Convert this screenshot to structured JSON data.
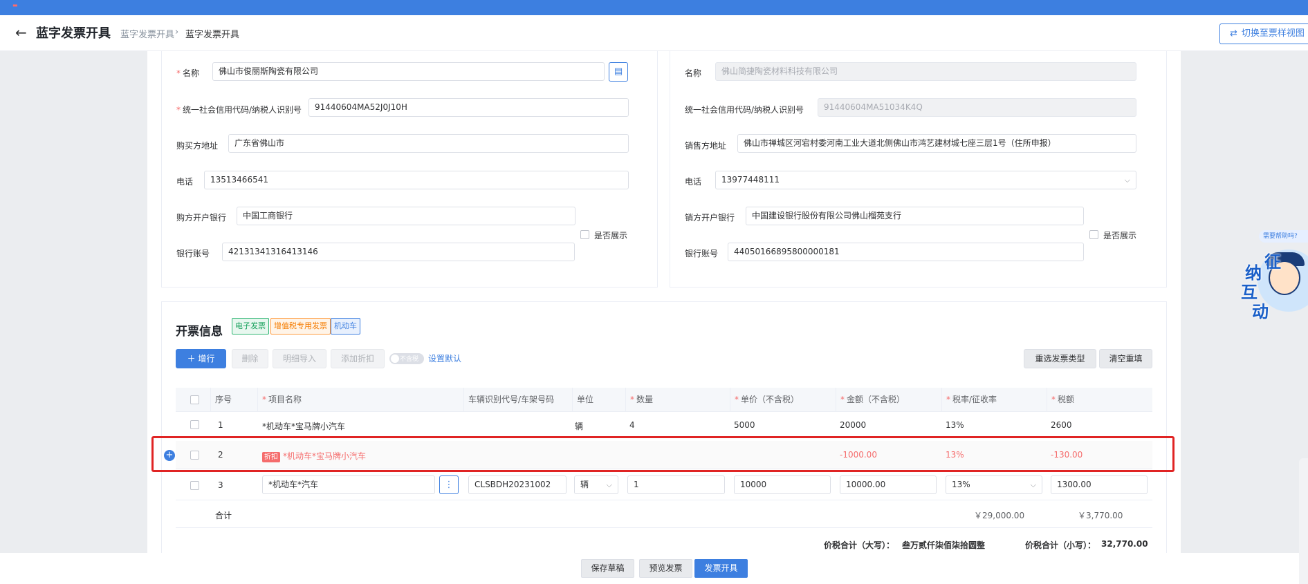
{
  "header": {
    "title": "蓝字发票开具",
    "breadcrumb": [
      "蓝字发票开具",
      "蓝字发票开具"
    ],
    "switch_label": "切换至票样视图"
  },
  "buyer": {
    "name_label": "名称",
    "name_value": "佛山市俊丽斯陶瓷有限公司",
    "tax_label": "统一社会信用代码/纳税人识别号",
    "tax_value": "91440604MA52J0J10H",
    "address_label": "购买方地址",
    "address_value": "广东省佛山市",
    "phone_label": "电话",
    "phone_value": "13513466541",
    "bank_label": "购方开户银行",
    "bank_value": "中国工商银行",
    "account_label": "银行账号",
    "account_value": "42131341316413146",
    "show_label": "是否展示"
  },
  "seller": {
    "name_label": "名称",
    "name_value": "佛山简捷陶瓷材料科技有限公司",
    "tax_label": "统一社会信用代码/纳税人识别号",
    "tax_value": "91440604MA51034K4Q",
    "address_label": "销售方地址",
    "address_value": "佛山市禅城区河宕村委河南工业大道北侧佛山市鸿艺建材城七座三层1号（住所申报）",
    "phone_label": "电话",
    "phone_value": "13977448111",
    "bank_label": "销方开户银行",
    "bank_value": "中国建设银行股份有限公司佛山榴苑支行",
    "account_label": "银行账号",
    "account_value": "44050166895800000181",
    "show_label": "是否展示"
  },
  "invoice": {
    "title": "开票信息",
    "tags": [
      "电子发票",
      "增值税专用发票",
      "机动车"
    ],
    "toolbar": {
      "add": "增行",
      "delete": "删除",
      "import": "明细导入",
      "discount": "添加折扣",
      "toggle": "不含税",
      "set_default": "设置默认",
      "reselect": "重选发票类型",
      "clear": "清空重填"
    },
    "columns": [
      "序号",
      "项目名称",
      "车辆识别代号/车架号码",
      "单位",
      "数量",
      "单价（不含税）",
      "金额（不含税）",
      "税率/征收率",
      "税额"
    ],
    "rows": [
      {
        "no": "1",
        "name": "*机动车*宝马牌小汽车",
        "vin": "",
        "unit": "辆",
        "qty": "4",
        "price": "5000",
        "amount": "20000",
        "rate": "13%",
        "tax": "2600"
      },
      {
        "no": "2",
        "badge": "折扣",
        "name": "*机动车*宝马牌小汽车",
        "vin": "",
        "unit": "",
        "qty": "",
        "price": "",
        "amount": "-1000.00",
        "rate": "13%",
        "tax": "-130.00"
      },
      {
        "no": "3",
        "name": "*机动车*汽车",
        "vin": "CLSBDH20231002",
        "unit": "辆",
        "qty": "1",
        "price": "10000",
        "amount": "10000.00",
        "rate": "13%",
        "tax": "1300.00"
      }
    ],
    "subtotal_label": "合计",
    "subtotal_amount": "￥29,000.00",
    "subtotal_tax": "￥3,770.00",
    "total_upper_label": "价税合计（大写）：",
    "total_upper_value": "叁万贰仟柒佰柒拾圆整",
    "total_lower_label": "价税合计（小写）：",
    "total_lower_value": "32,770.00"
  },
  "footer": {
    "save": "保存草稿",
    "preview": "预览发票",
    "issue": "发票开具"
  },
  "helper": {
    "bubble": "需要帮助吗?",
    "chars": [
      "征",
      "纳",
      "互",
      "动"
    ]
  }
}
